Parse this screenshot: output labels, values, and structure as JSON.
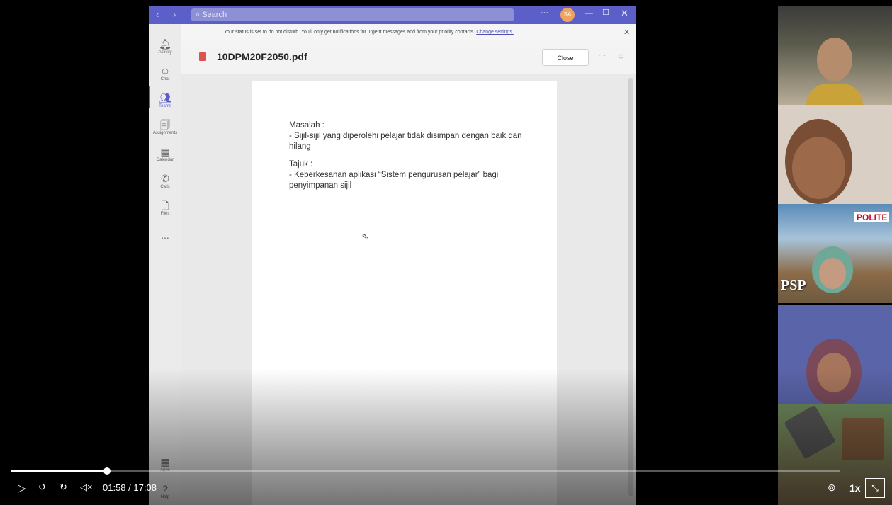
{
  "teams": {
    "search_placeholder": "Search",
    "avatar_initials": "SA",
    "rail": [
      {
        "label": "Activity",
        "icon": "bell-icon"
      },
      {
        "label": "Chat",
        "icon": "chat-icon"
      },
      {
        "label": "Teams",
        "icon": "teams-icon"
      },
      {
        "label": "Assignments",
        "icon": "assignments-icon"
      },
      {
        "label": "Calendar",
        "icon": "calendar-icon"
      },
      {
        "label": "Calls",
        "icon": "phone-icon"
      },
      {
        "label": "Files",
        "icon": "file-icon"
      },
      {
        "label": "...",
        "icon": "more-icon"
      }
    ],
    "rail_bottom": [
      {
        "label": "Apps",
        "icon": "apps-icon"
      },
      {
        "label": "Help",
        "icon": "help-icon"
      }
    ],
    "notice_text": "Your status is set to do not disturb. You'll only get notifications for urgent messages and from your priority contacts.",
    "notice_link": "Change settings.",
    "file_name": "10DPM20F2050.pdf",
    "close_label": "Close",
    "more_label": "···"
  },
  "document": {
    "lines": [
      "Masalah :",
      "- Sijil-sijil yang diperolehi pelajar tidak disimpan dengan baik dan hilang",
      "Tajuk :",
      "- Keberkesanan aplikasi “Sistem pengurusan pelajar” bagi penyimpanan sijil"
    ]
  },
  "participants": {
    "psp_logo": "PSP",
    "polite_logo": "POLITE"
  },
  "player": {
    "current_time": "01:58",
    "separator": " / ",
    "duration": "17:08",
    "speed": "1x",
    "progress_fraction": 0.115
  }
}
